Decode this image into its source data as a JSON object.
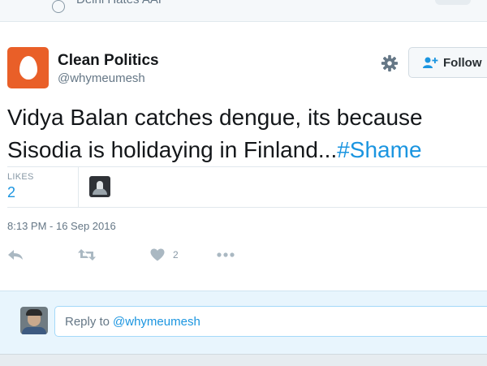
{
  "top_strip": {
    "partial_text": "Delhi Hates AAP"
  },
  "tweet": {
    "author_name": "Clean Politics",
    "handle": "@whymeumesh",
    "text_line1": "Vidya Balan catches dengue, its because",
    "text_line2": "Sisodia is holidaying in Finland...",
    "hashtag": "#Shame",
    "likes_label": "LIKES",
    "likes_count": "2",
    "timestamp": "8:13 PM - 16 Sep 2016",
    "like_action_count": "2"
  },
  "follow_button": {
    "label": "Follow"
  },
  "reply_box": {
    "prefix": "Reply to",
    "mention": "@whymeumesh"
  },
  "icons": {
    "settings": "gear-icon",
    "follow": "add-user-icon",
    "reply": "reply-icon",
    "retweet": "retweet-icon",
    "like": "heart-icon",
    "more": "more-icon"
  },
  "colors": {
    "link": "#1b95e0",
    "avatar_bg": "#e95f28",
    "reply_bg": "#e8f5fd"
  }
}
